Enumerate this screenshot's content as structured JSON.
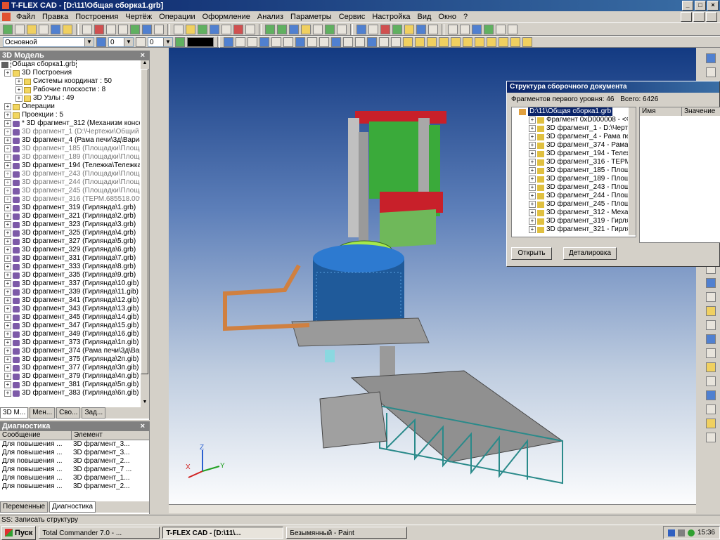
{
  "app": {
    "title": "T-FLEX CAD - [D:\\11\\Общая сборка1.grb]"
  },
  "menu": [
    "Файл",
    "Правка",
    "Построения",
    "Чертёж",
    "Операции",
    "Оформление",
    "Анализ",
    "Параметры",
    "Сервис",
    "Настройка",
    "Вид",
    "Окно",
    "?"
  ],
  "toolbar2": {
    "layer": "Основной",
    "value1": "0",
    "value2": "0"
  },
  "model_panel": {
    "title": "3D Модель",
    "root": "Общая сборка1.grb",
    "items": [
      {
        "label": "3D Построения",
        "level": 0,
        "kind": "folder",
        "grey": false
      },
      {
        "label": "Системы координат : 50",
        "level": 1,
        "kind": "folder",
        "grey": false
      },
      {
        "label": "Рабочие плоскости : 8",
        "level": 1,
        "kind": "folder",
        "grey": false
      },
      {
        "label": "3D Узлы : 49",
        "level": 1,
        "kind": "folder",
        "grey": false
      },
      {
        "label": "Операции",
        "level": 0,
        "kind": "folder",
        "grey": false
      },
      {
        "label": "Проекции : 5",
        "level": 0,
        "kind": "folder",
        "grey": false
      },
      {
        "label": "* 3D фрагмент_312 (Механизм консольн",
        "level": 0,
        "kind": "part",
        "grey": false
      },
      {
        "label": "3D фрагмент_1 (D:\\Чертежи\\Общий вид",
        "level": 0,
        "kind": "part",
        "grey": true
      },
      {
        "label": "3D фрагмент_4 (Рама печи\\3д\\Вариант2",
        "level": 0,
        "kind": "part",
        "grey": false
      },
      {
        "label": "3D фрагмент_185 (Площадки\\Площадка",
        "level": 0,
        "kind": "part",
        "grey": true
      },
      {
        "label": "3D фрагмент_189 (Площадки\\Площадка",
        "level": 0,
        "kind": "part",
        "grey": true
      },
      {
        "label": "3D фрагмент_194 (Тележка\\Тележка на",
        "level": 0,
        "kind": "part",
        "grey": false
      },
      {
        "label": "3D фрагмент_243 (Площадки\\Площадка",
        "level": 0,
        "kind": "part",
        "grey": true
      },
      {
        "label": "3D фрагмент_244 (Площадки\\Площадка",
        "level": 0,
        "kind": "part",
        "grey": true
      },
      {
        "label": "3D фрагмент_245 (Площадки\\Площадка",
        "level": 0,
        "kind": "part",
        "grey": true
      },
      {
        "label": "3D фрагмент_316 (ТЕРМ.685518.009 Сеч",
        "level": 0,
        "kind": "part",
        "grey": true
      },
      {
        "label": "3D фрагмент_319 (Гирлянда\\1.grb)",
        "level": 0,
        "kind": "part",
        "grey": false
      },
      {
        "label": "3D фрагмент_321 (Гирлянда\\2.grb)",
        "level": 0,
        "kind": "part",
        "grey": false
      },
      {
        "label": "3D фрагмент_323 (Гирлянда\\3.grb)",
        "level": 0,
        "kind": "part",
        "grey": false
      },
      {
        "label": "3D фрагмент_325 (Гирлянда\\4.grb)",
        "level": 0,
        "kind": "part",
        "grey": false
      },
      {
        "label": "3D фрагмент_327 (Гирлянда\\5.grb)",
        "level": 0,
        "kind": "part",
        "grey": false
      },
      {
        "label": "3D фрагмент_329 (Гирлянда\\6.grb)",
        "level": 0,
        "kind": "part",
        "grey": false
      },
      {
        "label": "3D фрагмент_331 (Гирлянда\\7.grb)",
        "level": 0,
        "kind": "part",
        "grey": false
      },
      {
        "label": "3D фрагмент_333 (Гирлянда\\8.grb)",
        "level": 0,
        "kind": "part",
        "grey": false
      },
      {
        "label": "3D фрагмент_335 (Гирлянда\\9.grb)",
        "level": 0,
        "kind": "part",
        "grey": false
      },
      {
        "label": "3D фрагмент_337 (Гирлянда\\10.gib)",
        "level": 0,
        "kind": "part",
        "grey": false
      },
      {
        "label": "3D фрагмент_339 (Гирлянда\\11.gib)",
        "level": 0,
        "kind": "part",
        "grey": false
      },
      {
        "label": "3D фрагмент_341 (Гирлянда\\12.gib)",
        "level": 0,
        "kind": "part",
        "grey": false
      },
      {
        "label": "3D фрагмент_343 (Гирлянда\\13.gib)",
        "level": 0,
        "kind": "part",
        "grey": false
      },
      {
        "label": "3D фрагмент_345 (Гирлянда\\14.gib)",
        "level": 0,
        "kind": "part",
        "grey": false
      },
      {
        "label": "3D фрагмент_347 (Гирлянда\\15.gib)",
        "level": 0,
        "kind": "part",
        "grey": false
      },
      {
        "label": "3D фрагмент_349 (Гирлянда\\16.gib)",
        "level": 0,
        "kind": "part",
        "grey": false
      },
      {
        "label": "3D фрагмент_373 (Гирлянда\\1п.gib)",
        "level": 0,
        "kind": "part",
        "grey": false
      },
      {
        "label": "3D фрагмент_374 (Рама печи\\3д\\Варна",
        "level": 0,
        "kind": "part",
        "grey": false
      },
      {
        "label": "3D фрагмент_375 (Гирлянда\\2п.gib)",
        "level": 0,
        "kind": "part",
        "grey": false
      },
      {
        "label": "3D фрагмент_377 (Гирлянда\\3п.gib)",
        "level": 0,
        "kind": "part",
        "grey": false
      },
      {
        "label": "3D фрагмент_379 (Гирлянда\\4п.gib)",
        "level": 0,
        "kind": "part",
        "grey": false
      },
      {
        "label": "3D фрагмент_381 (Гирлянда\\5п.gib)",
        "level": 0,
        "kind": "part",
        "grey": false
      },
      {
        "label": "3D фрагмент_383 (Гирлянда\\6п.gib)",
        "level": 0,
        "kind": "part",
        "grey": false
      }
    ],
    "tabs": [
      "3D М...",
      "Мен...",
      "Сво...",
      "Зад..."
    ]
  },
  "diagnostics": {
    "title": "Диагностика",
    "col_message": "Сообщение",
    "col_element": "Элемент",
    "rows": [
      {
        "message": "Для повышения ...",
        "element": "3D фрагмент_3..."
      },
      {
        "message": "Для повышения ...",
        "element": "3D фрагмент_3..."
      },
      {
        "message": "Для повышения ...",
        "element": "3D фрагмент_2..."
      },
      {
        "message": "Для повышения ...",
        "element": "3D фрагмент_7 ..."
      },
      {
        "message": "Для повышения ...",
        "element": "3D фрагмент_1..."
      },
      {
        "message": "Для повышения ...",
        "element": "3D фрагмент_2..."
      }
    ],
    "tabs": [
      "Переменные",
      "Диагностика"
    ]
  },
  "axes": {
    "x": "X",
    "y": "Y",
    "z": "Z"
  },
  "dialog": {
    "title": "Структура сборочного документа",
    "summary_label": "Фрагментов первого уровня:",
    "summary_count": "46",
    "total_label": "Всего:",
    "total_count": "6426",
    "root": "D:\\11\\Общая сборка1.grb",
    "items": [
      "Фрагмент 0xD000008 - <Фор",
      "3D фрагмент_1 - D:\\Чертежи",
      "3D фрагмент_4 - Рама печи\\",
      "3D фрагмент_374 - Рама пе",
      "3D фрагмент_194 - Тележка",
      "3D фрагмент_316 - ТЕРМ.68",
      "3D фрагмент_185 - Площади",
      "3D фрагмент_189 - Площади",
      "3D фрагмент_243 - Площади",
      "3D фрагмент_244 - Площади",
      "3D фрагмент_245 - Площади",
      "3D фрагмент_312 - Механиз",
      "3D фрагмент_319 - Гирлянд",
      "3D фрагмент_321 - Гирлянд"
    ],
    "col_name": "Имя",
    "col_value": "Значение",
    "open_button": "Открыть",
    "detail_button": "Деталировка"
  },
  "status": "SS: Записать структуру",
  "taskbar": {
    "start": "Пуск",
    "tasks": [
      "Total Commander 7.0 - ...",
      "T-FLEX CAD - [D:\\11\\...",
      "Безымянный - Paint"
    ],
    "clock": "15:36"
  }
}
